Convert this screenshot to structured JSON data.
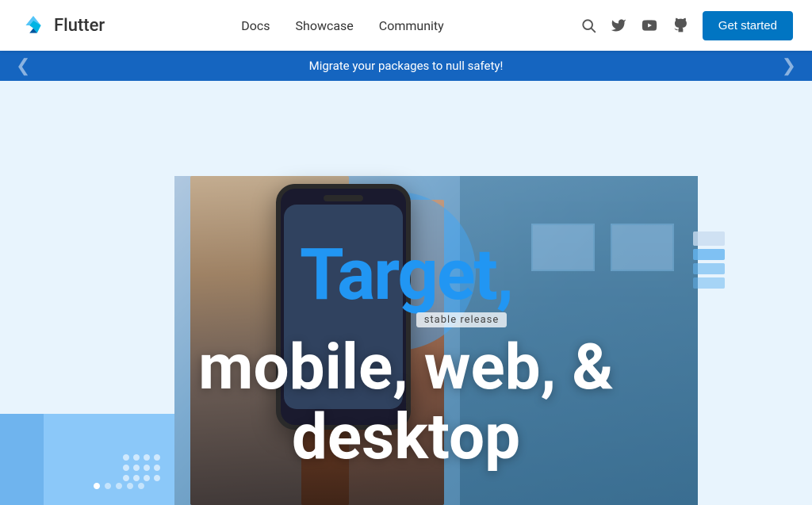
{
  "navbar": {
    "brand": "Flutter",
    "nav_links": [
      {
        "label": "Docs",
        "id": "docs"
      },
      {
        "label": "Showcase",
        "id": "showcase"
      },
      {
        "label": "Community",
        "id": "community"
      }
    ],
    "get_started_label": "Get started",
    "search_icon": "search",
    "twitter_icon": "twitter",
    "youtube_icon": "youtube",
    "github_icon": "github"
  },
  "banner": {
    "text": "Migrate your packages to null safety!",
    "left_chevron": "‹",
    "right_chevron": "›"
  },
  "hero": {
    "title_line1": "Target,",
    "release_tag": "stable release",
    "title_line2": "mobile, web, &",
    "title_line3": "desktop",
    "dots": [
      {
        "active": true
      },
      {
        "active": false
      },
      {
        "active": false
      },
      {
        "active": false
      },
      {
        "active": false
      }
    ]
  }
}
